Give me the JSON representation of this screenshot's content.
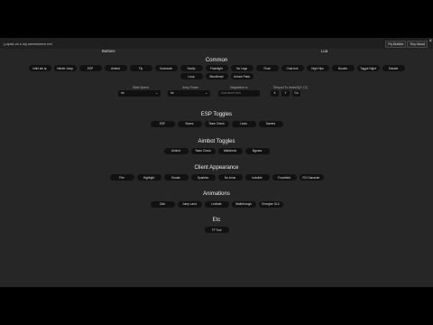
{
  "header": {
    "url": "j-ulpsk.vk.s.lny.wewedzere.net"
  },
  "top_buttons": [
    "Fly Bubble",
    "Tiny Mood"
  ],
  "close_label": "×",
  "tabs": [
    "Buttons",
    "Lua"
  ],
  "sections": {
    "common": {
      "title": "Common",
      "row1": [
        "infini stk tp",
        "Infinite Jump",
        "ESP",
        "Aimbot",
        "Fly",
        "Godmode",
        "Noclip",
        "Flashlight",
        "No Legs",
        "Float",
        "Chat troll",
        "High Hips",
        "Boosts",
        "Toggle Night",
        "Suicide"
      ],
      "row2": [
        "Loop",
        "Blockhead",
        "Unlock Parts"
      ]
    },
    "settings": {
      "walk_speed_label": "Walk Speed",
      "walk_speed_value": "he",
      "jump_power_label": "Jump Power",
      "jump_power_value": "he",
      "player_label": "Magnetize to",
      "player_placeholder": "Username here",
      "teleport_label": "Teleport To Vector3(X,Y,Z)",
      "teleport_buttons": [
        "X",
        "Y",
        "Go"
      ],
      "arrow": "⌄"
    },
    "esp": {
      "title": "ESP Toggles",
      "buttons": [
        "ESP",
        "Boxes",
        "Team Check",
        "Lines",
        "Names"
      ]
    },
    "aimbot": {
      "title": "Aimbot Toggles",
      "buttons": [
        "Aimbot",
        "Team Check",
        "Wallcheck",
        "Bypass"
      ]
    },
    "client": {
      "title": "Client Appearance",
      "buttons": [
        "Fire",
        "Highlight",
        "Smoke",
        "Sparkles",
        "No Arms",
        "Invisible",
        "Forcefield",
        "R3 Character"
      ]
    },
    "animations": {
      "title": "Animations",
      "buttons": [
        "Dab",
        "Jump Land",
        "Levitate",
        "Walkthrough",
        "Energize GUI"
      ]
    },
    "etc": {
      "title": "Etc",
      "buttons": [
        "TP Tool"
      ]
    }
  }
}
